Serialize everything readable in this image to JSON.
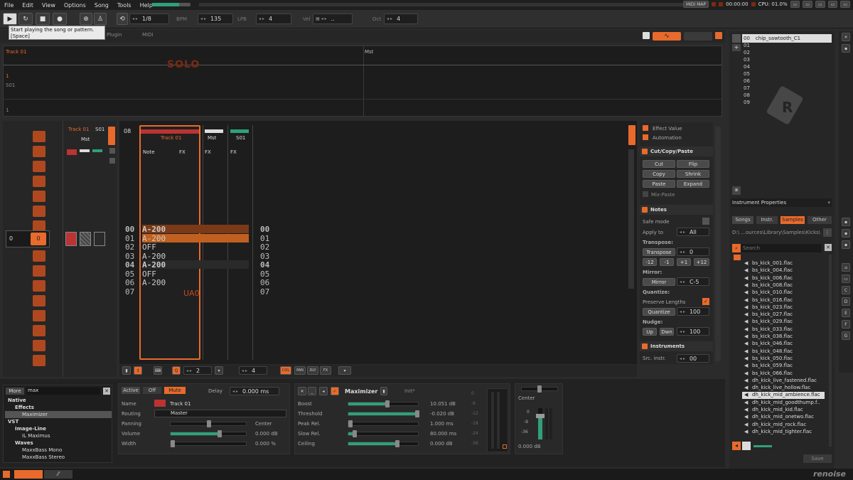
{
  "menu": [
    "File",
    "Edit",
    "View",
    "Options",
    "Song",
    "Tools",
    "Help"
  ],
  "status_right": {
    "midi_map": "MIDI MAP",
    "time": "00:00:00",
    "cpu": "CPU: 01.0%"
  },
  "toolbar": {
    "pattern_counter": "1/8",
    "bpm_label": "BPM",
    "bpm": "135",
    "lpb_label": "LPB",
    "lpb": "4",
    "vel_label": "Vel",
    "vel": "..",
    "oct_label": "Oct",
    "oct": "4"
  },
  "tooltip": {
    "line1": "Start playing the song or pattern.",
    "line2": "[Space]"
  },
  "tabs": [
    "Plugin",
    "MIDI"
  ],
  "matrix": {
    "track1": "Track 01",
    "master": "Mst",
    "solo_text": "SOLO",
    "row1": "1",
    "row2": "S01",
    "row3": "1"
  },
  "track_headers": {
    "track01": "Track 01",
    "mst": "Mst",
    "s01": "S01",
    "note_col": "Note",
    "fx_col": "FX",
    "solo": "SOLO",
    "play": "PLAY",
    "lines_count": "08"
  },
  "mixer_left": {
    "track": "Track 01",
    "mst": "Mst",
    "s01": "S01",
    "value_a": "0",
    "value_b": "0"
  },
  "pattern_rows": [
    {
      "n": "00",
      "note": "A-200",
      "hl": true
    },
    {
      "n": "01",
      "note": "A-200",
      "hl": false
    },
    {
      "n": "02",
      "note": "OFF",
      "hl": false
    },
    {
      "n": "03",
      "note": "A-200",
      "hl": false
    },
    {
      "n": "04",
      "note": "A-200",
      "hl": true
    },
    {
      "n": "05",
      "note": "OFF",
      "hl": false
    },
    {
      "n": "06",
      "note": "A-200",
      "hl": false
    },
    {
      "n": "07",
      "note": "",
      "hl": false
    }
  ],
  "pattern_extra": {
    "ua0": "UA0"
  },
  "tools": {
    "effect_value": "Effect Value",
    "automation": "Automation",
    "ccp_title": "Cut/Copy/Paste",
    "cut": "Cut",
    "flip": "Flip",
    "copy": "Copy",
    "shrink": "Shrink",
    "paste": "Paste",
    "expand": "Expand",
    "mix_paste": "Mix-Paste",
    "notes_title": "Notes",
    "safe_mode": "Safe mode",
    "apply_to": "Apply to",
    "apply_to_val": "All",
    "transpose_label": "Transpose:",
    "transpose_btn": "Transpose",
    "transpose_val": "0",
    "t_m12": "-12",
    "t_m1": "-1",
    "t_p1": "+1",
    "t_p12": "+12",
    "mirror_label": "Mirror:",
    "mirror_btn": "Mirror",
    "mirror_val": "C-5",
    "quantize_label": "Quantize:",
    "preserve_lengths": "Preserve Lengths",
    "quantize_btn": "Quantize",
    "quantize_val": "100",
    "nudge_label": "Nudge:",
    "up": "Up",
    "dwn": "Dwn",
    "nudge_val": "100",
    "instruments_title": "Instruments",
    "src_instr": "Src. instr.",
    "src_instr_val": "00"
  },
  "bottom_bar": {
    "q_val": "2",
    "edit_step": "4",
    "btn_col": "COL",
    "btn_pan": "PAN",
    "btn_dly": "DLY",
    "btn_fx": "FX"
  },
  "browser": {
    "more": "More",
    "search": "max",
    "tree": [
      {
        "label": "Native",
        "level": 0
      },
      {
        "label": "Effects",
        "level": 1
      },
      {
        "label": "Maximizer",
        "level": 2,
        "selected": true
      },
      {
        "label": "VST",
        "level": 0
      },
      {
        "label": "Image-Line",
        "level": 1
      },
      {
        "label": "IL Maximus",
        "level": 2
      },
      {
        "label": "Waves",
        "level": 1
      },
      {
        "label": "MaxxBass Mono",
        "level": 2
      },
      {
        "label": "MaxxBass Stereo",
        "level": 2
      }
    ]
  },
  "track_dsp": {
    "active": "Active",
    "off": "Off",
    "mute": "Mute",
    "delay_label": "Delay",
    "delay_val": "0.000 ms",
    "name_label": "Name",
    "name_val": "Track 01",
    "routing_label": "Routing",
    "routing_val": "Master",
    "panning_label": "Panning",
    "panning_val": "Center",
    "volume_label": "Volume",
    "volume_val": "0.000 dB",
    "width_label": "Width",
    "width_val": "0.000 %"
  },
  "maximizer": {
    "title": "Maximizer",
    "preset": "Init*",
    "params": [
      {
        "label": "Boost",
        "value": "10.051 dB",
        "level": 0.55
      },
      {
        "label": "Threshold",
        "value": "-0.020 dB",
        "level": 1.0
      },
      {
        "label": "Peak Rel.",
        "value": "1.000 ms",
        "level": 0.0
      },
      {
        "label": "Slow Rel.",
        "value": "80.000 ms",
        "level": 0.06
      },
      {
        "label": "Ceiling",
        "value": "0.000 dB",
        "level": 0.7
      }
    ],
    "meter_ticks": [
      "0",
      "-6",
      "-12",
      "-18",
      "-24",
      "-36"
    ]
  },
  "output": {
    "center": "Center",
    "t0": "0",
    "t9": "-9",
    "t36": "-36",
    "db": "0.000 dB"
  },
  "instrument": {
    "slot": "00",
    "name": "chip_sawtooth_C1",
    "list": [
      "01",
      "02",
      "03",
      "04",
      "05",
      "06",
      "07",
      "08",
      "09"
    ],
    "props": "Instrument Properties",
    "tabs": [
      "Songs",
      "Instr.",
      "Samples",
      "Other"
    ],
    "path": "D:\\ ...ources\\Library\\Samples\\Kicks\\",
    "search_placeholder": "Search",
    "files": [
      "bs_kick_001.flac",
      "bs_kick_004.flac",
      "bs_kick_006.flac",
      "bs_kick_008.flac",
      "bs_kick_010.flac",
      "bs_kick_016.flac",
      "bs_kick_023.flac",
      "bs_kick_027.flac",
      "bs_kick_029.flac",
      "bs_kick_033.flac",
      "bs_kick_038.flac",
      "bs_kick_046.flac",
      "bs_kick_048.flac",
      "bs_kick_050.flac",
      "bs_kick_059.flac",
      "bs_kick_066.flac",
      "dh_kick_live_fastened.flac",
      "dh_kick_live_hollow.flac",
      "dh_kick_mid_ambience.flac",
      "dh_kick_mid_goodthump.f..",
      "dh_kick_mid_kid.flac",
      "dh_kick_mid_onetwo.flac",
      "dh_kick_mid_rock.flac",
      "dh_kick_mid_tighter.flac"
    ],
    "selected_file": "dh_kick_mid_ambience.flac",
    "save": "Save"
  },
  "sidebar_letters": [
    "C",
    "D",
    "E",
    "F",
    "G"
  ],
  "brand": "renoise"
}
